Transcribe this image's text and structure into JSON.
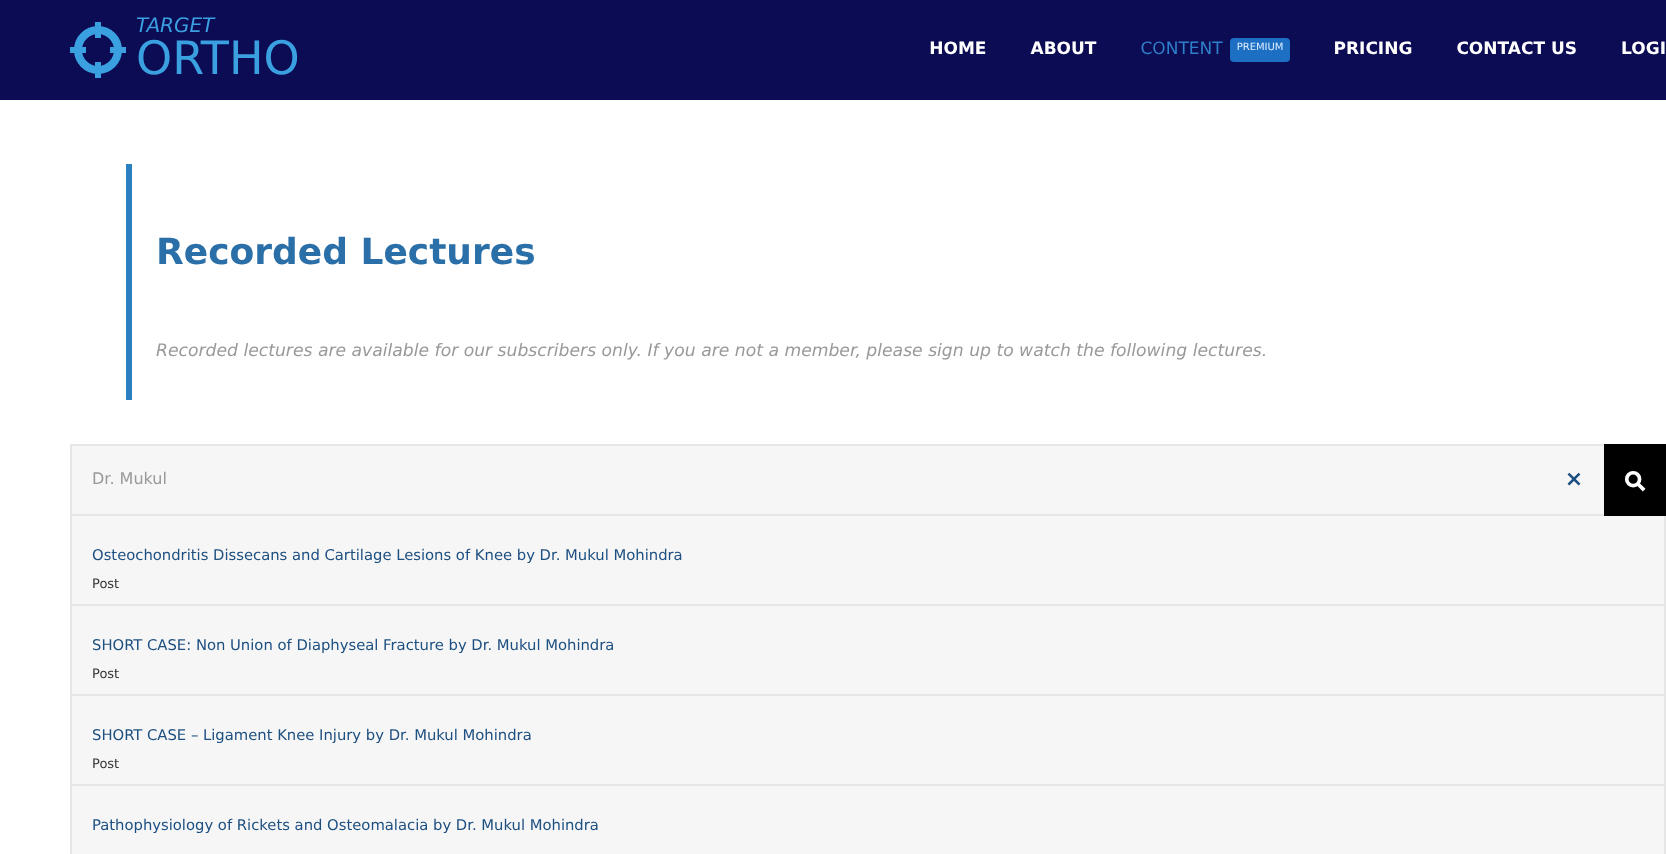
{
  "logo": {
    "small": "TARGET",
    "large": "ORTHO"
  },
  "nav": [
    {
      "label": "HOME",
      "selected": false
    },
    {
      "label": "ABOUT",
      "selected": false
    },
    {
      "label": "CONTENT",
      "selected": true,
      "badge": "PREMIUM"
    },
    {
      "label": "PRICING",
      "selected": false
    },
    {
      "label": "CONTACT US",
      "selected": false
    },
    {
      "label": "LOGI",
      "selected": false
    }
  ],
  "heading": "Recorded Lectures",
  "intro": "Recorded lectures are available for our subscribers only. If you are not a member, please sign up to watch the following lectures.",
  "search": {
    "value": "Dr. Mukul",
    "clear": "×"
  },
  "results": [
    {
      "title": "Osteochondritis Dissecans and Cartilage Lesions of Knee by Dr. Mukul Mohindra",
      "type": "Post"
    },
    {
      "title": "SHORT CASE: Non Union of Diaphyseal Fracture by Dr. Mukul Mohindra",
      "type": "Post"
    },
    {
      "title": "SHORT CASE – Ligament Knee Injury by Dr. Mukul Mohindra",
      "type": "Post"
    },
    {
      "title": "Pathophysiology of Rickets and Osteomalacia by Dr. Mukul Mohindra"
    }
  ]
}
